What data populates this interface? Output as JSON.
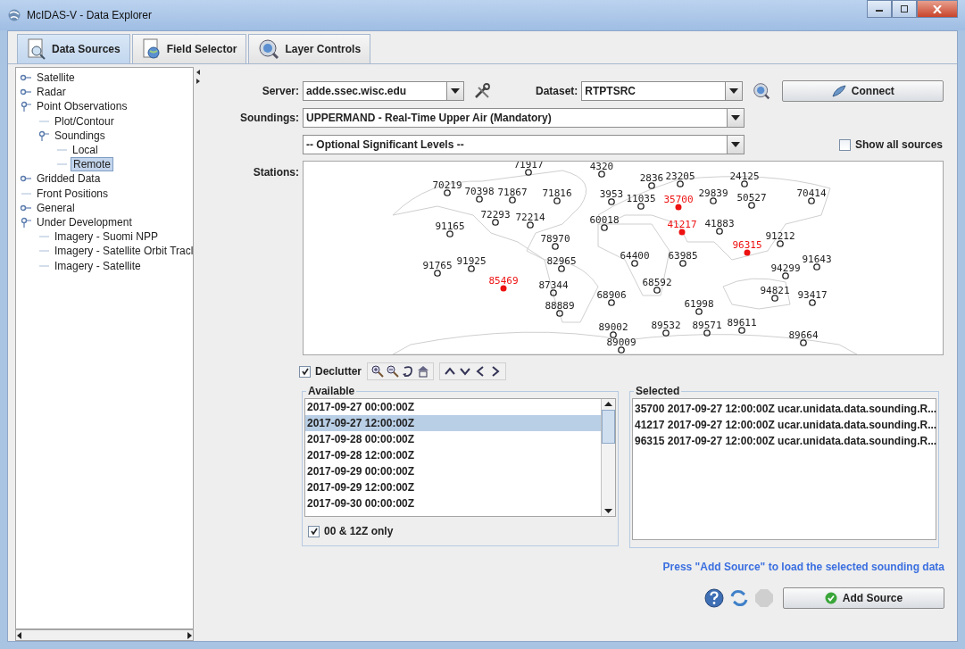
{
  "window": {
    "title": "McIDAS-V - Data Explorer"
  },
  "tabs": [
    {
      "label": "Data Sources",
      "selected": true,
      "kind": "sources"
    },
    {
      "label": "Field Selector",
      "selected": false,
      "kind": "fields"
    },
    {
      "label": "Layer Controls",
      "selected": false,
      "kind": "layers"
    }
  ],
  "tree": [
    {
      "label": "Satellite",
      "expanded": false,
      "selected": false
    },
    {
      "label": "Radar",
      "expanded": false,
      "selected": false
    },
    {
      "label": "Point Observations",
      "expanded": true,
      "selected": false,
      "children": [
        {
          "label": "Plot/Contour",
          "selected": false
        },
        {
          "label": "Soundings",
          "expanded": true,
          "selected": false,
          "children": [
            {
              "label": "Local",
              "selected": false
            },
            {
              "label": "Remote",
              "selected": true
            }
          ]
        }
      ]
    },
    {
      "label": "Gridded Data",
      "expanded": false,
      "selected": false
    },
    {
      "label": "Front Positions",
      "selected": false
    },
    {
      "label": "General",
      "expanded": false,
      "selected": false
    },
    {
      "label": "Under Development",
      "expanded": true,
      "selected": false,
      "children": [
        {
          "label": "Imagery - Suomi NPP",
          "selected": false
        },
        {
          "label": "Imagery - Satellite Orbit Tracl",
          "selected": false
        },
        {
          "label": "Imagery - Satellite",
          "selected": false
        }
      ]
    }
  ],
  "server": {
    "label": "Server:",
    "value": "adde.ssec.wisc.edu"
  },
  "dataset": {
    "label": "Dataset:",
    "value": "RTPTSRC"
  },
  "connect_button": "Connect",
  "soundings": {
    "label": "Soundings:",
    "value": "UPPERMAND - Real-Time Upper Air (Mandatory)"
  },
  "significant_levels": {
    "value": "-- Optional Significant Levels --"
  },
  "show_all_sources": {
    "label": "Show all sources",
    "checked": false
  },
  "stations": {
    "label": "Stations:",
    "items": [
      {
        "id": "71917",
        "selected": false
      },
      {
        "id": "4320",
        "selected": false
      },
      {
        "id": "70219",
        "selected": false
      },
      {
        "id": "70398",
        "selected": false
      },
      {
        "id": "71867",
        "selected": false
      },
      {
        "id": "71816",
        "selected": false
      },
      {
        "id": "3953",
        "selected": false
      },
      {
        "id": "72293",
        "selected": false
      },
      {
        "id": "72214",
        "selected": false
      },
      {
        "id": "91165",
        "selected": false
      },
      {
        "id": "60018",
        "selected": false
      },
      {
        "id": "78970",
        "selected": false
      },
      {
        "id": "91765",
        "selected": false
      },
      {
        "id": "91925",
        "selected": false
      },
      {
        "id": "85469",
        "selected": true
      },
      {
        "id": "82965",
        "selected": false
      },
      {
        "id": "87344",
        "selected": false
      },
      {
        "id": "68906",
        "selected": false
      },
      {
        "id": "88889",
        "selected": false
      },
      {
        "id": "89002",
        "selected": false
      },
      {
        "id": "89009",
        "selected": false
      },
      {
        "id": "2836",
        "selected": false
      },
      {
        "id": "23205",
        "selected": false
      },
      {
        "id": "24125",
        "selected": false
      },
      {
        "id": "11035",
        "selected": false
      },
      {
        "id": "35700",
        "selected": true
      },
      {
        "id": "29839",
        "selected": false
      },
      {
        "id": "50527",
        "selected": false
      },
      {
        "id": "70414",
        "selected": false
      },
      {
        "id": "41217",
        "selected": true
      },
      {
        "id": "41883",
        "selected": false
      },
      {
        "id": "91212",
        "selected": false
      },
      {
        "id": "96315",
        "selected": true
      },
      {
        "id": "64400",
        "selected": false
      },
      {
        "id": "63985",
        "selected": false
      },
      {
        "id": "91643",
        "selected": false
      },
      {
        "id": "94299",
        "selected": false
      },
      {
        "id": "68592",
        "selected": false
      },
      {
        "id": "94821",
        "selected": false
      },
      {
        "id": "93417",
        "selected": false
      },
      {
        "id": "61998",
        "selected": false
      },
      {
        "id": "89532",
        "selected": false
      },
      {
        "id": "89571",
        "selected": false
      },
      {
        "id": "89611",
        "selected": false
      },
      {
        "id": "89664",
        "selected": false
      }
    ]
  },
  "declutter": {
    "label": "Declutter",
    "checked": true
  },
  "available": {
    "title": "Available",
    "items": [
      {
        "label": "2017-09-27 00:00:00Z",
        "selected": false
      },
      {
        "label": "2017-09-27 12:00:00Z",
        "selected": true
      },
      {
        "label": "2017-09-28 00:00:00Z",
        "selected": false
      },
      {
        "label": "2017-09-28 12:00:00Z",
        "selected": false
      },
      {
        "label": "2017-09-29 00:00:00Z",
        "selected": false
      },
      {
        "label": "2017-09-29 12:00:00Z",
        "selected": false
      },
      {
        "label": "2017-09-30 00:00:00Z",
        "selected": false
      }
    ]
  },
  "only_00_12z": {
    "label": "00 & 12Z only",
    "checked": true
  },
  "selected_list": {
    "title": "Selected",
    "items": [
      "35700 2017-09-27 12:00:00Z ucar.unidata.data.sounding.R...",
      "41217 2017-09-27 12:00:00Z ucar.unidata.data.sounding.R...",
      "96315 2017-09-27 12:00:00Z ucar.unidata.data.sounding.R..."
    ]
  },
  "hint": "Press \"Add Source\" to load the selected sounding data",
  "add_source_button": "Add Source"
}
